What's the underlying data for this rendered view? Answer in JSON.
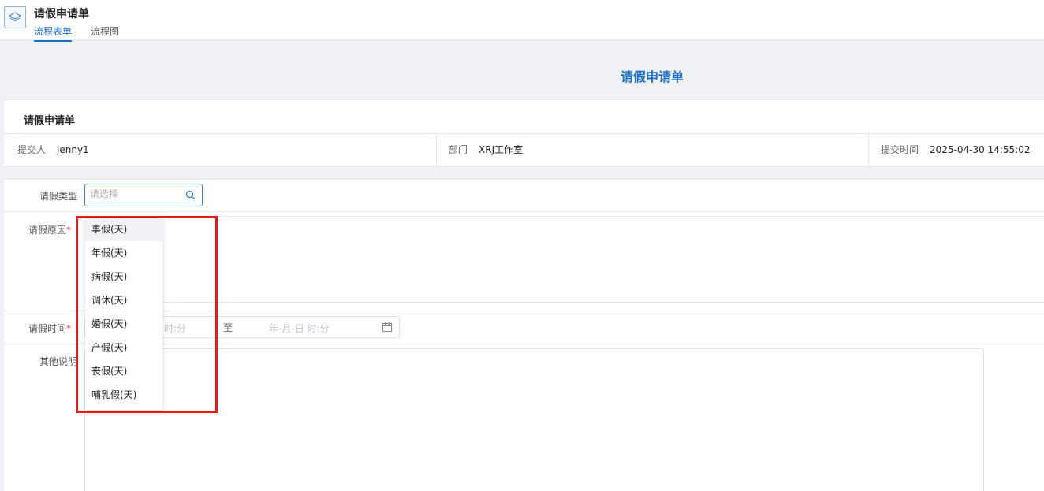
{
  "app": {
    "title": "请假申请单"
  },
  "tabs": [
    {
      "label": "流程表单",
      "active": true
    },
    {
      "label": "流程图",
      "active": false
    }
  ],
  "form": {
    "title": "请假申请单"
  },
  "info_card": {
    "title": "请假申请单",
    "submitter_label": "提交人",
    "submitter_value": "jenny1",
    "dept_label": "部门",
    "dept_value": "XRJ工作室",
    "time_label": "提交时间",
    "time_value": "2025-04-30 14:55:02"
  },
  "fields": {
    "leave_type_label": "请假类型",
    "leave_type_placeholder": "请选择",
    "reason_label": "请假原因",
    "time_label": "请假时间",
    "start_placeholder": "时:分",
    "to_label": "至",
    "end_placeholder": "年-月-日 时:分",
    "notes_label": "其他说明",
    "required_mark": "*"
  },
  "dropdown": {
    "options": [
      "事假(天)",
      "年假(天)",
      "病假(天)",
      "调休(天)",
      "婚假(天)",
      "产假(天)",
      "丧假(天)",
      "哺乳假(天)"
    ],
    "hovered_index": 0
  },
  "colors": {
    "accent": "#1b6fc2",
    "highlight": "#e8191b",
    "required": "#e53935"
  }
}
